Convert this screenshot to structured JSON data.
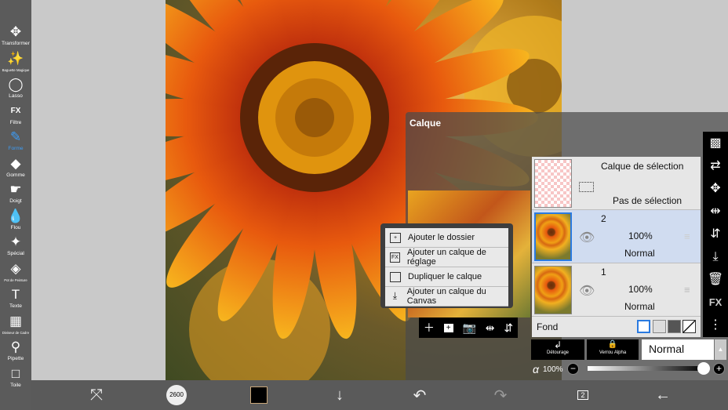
{
  "toolbar": {
    "items": [
      {
        "label": "Transformer",
        "icon": "move-icon"
      },
      {
        "label": "Baguette Magique",
        "icon": "magic-wand-icon"
      },
      {
        "label": "Lasso",
        "icon": "lasso-icon"
      },
      {
        "label": "Filtre",
        "icon": "fx-icon"
      },
      {
        "label": "Forme",
        "icon": "brush-icon",
        "active": true
      },
      {
        "label": "Gomme",
        "icon": "eraser-icon"
      },
      {
        "label": "Doigt",
        "icon": "smudge-icon"
      },
      {
        "label": "Flou",
        "icon": "blur-icon"
      },
      {
        "label": "Spécial",
        "icon": "special-icon"
      },
      {
        "label": "Pot de Peinture",
        "icon": "bucket-icon"
      },
      {
        "label": "Texte",
        "icon": "text-icon"
      },
      {
        "label": "Diviseur de Cadre",
        "icon": "frame-divider-icon"
      },
      {
        "label": "Pipette",
        "icon": "eyedropper-icon"
      },
      {
        "label": "Toile",
        "icon": "canvas-icon"
      }
    ]
  },
  "accent": "#3d9cf5",
  "bottombar": {
    "brush_size": "2600",
    "color": "#000000",
    "layer_count": "2"
  },
  "layer_panel": {
    "title": "Calque",
    "selection_layer": {
      "name": "Calque de sélection",
      "status": "Pas de sélection"
    },
    "layers": [
      {
        "name": "2",
        "opacity": "100%",
        "blend": "Normal",
        "selected": true
      },
      {
        "name": "1",
        "opacity": "100%",
        "blend": "Normal",
        "selected": false
      }
    ],
    "background_label": "Fond",
    "clipping_label": "Détourage",
    "alpha_lock_label": "Verrou Alpha",
    "blend_mode": "Normal",
    "alpha_symbol": "α",
    "opacity": "100%",
    "opacity_value": 100
  },
  "menu": {
    "items": [
      {
        "label": "Ajouter le dossier",
        "icon": "folder-add-icon"
      },
      {
        "label": "Ajouter un calque de réglage",
        "icon": "fx-icon"
      },
      {
        "label": "Dupliquer le calque",
        "icon": "duplicate-icon"
      },
      {
        "label": "Ajouter un calque du Canvas",
        "icon": "import-icon"
      }
    ]
  },
  "right_icons": [
    "checker-icon",
    "transfer-icon",
    "move-icon",
    "flip-horizontal-icon",
    "flip-vertical-icon",
    "merge-down-icon",
    "trash-icon",
    "fx-icon",
    "more-icon"
  ]
}
